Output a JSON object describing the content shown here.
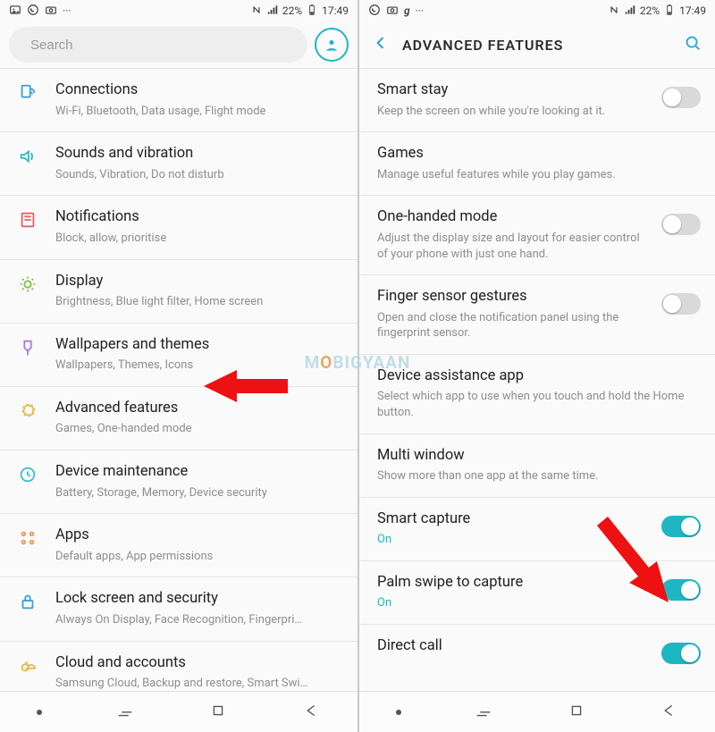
{
  "status": {
    "battery": "22%",
    "time": "17:49"
  },
  "left": {
    "search_placeholder": "Search",
    "items": [
      {
        "title": "Connections",
        "sub": "Wi-Fi, Bluetooth, Data usage, Flight mode"
      },
      {
        "title": "Sounds and vibration",
        "sub": "Sounds, Vibration, Do not disturb"
      },
      {
        "title": "Notifications",
        "sub": "Block, allow, prioritise"
      },
      {
        "title": "Display",
        "sub": "Brightness, Blue light filter, Home screen"
      },
      {
        "title": "Wallpapers and themes",
        "sub": "Wallpapers, Themes, Icons"
      },
      {
        "title": "Advanced features",
        "sub": "Games, One-handed mode"
      },
      {
        "title": "Device maintenance",
        "sub": "Battery, Storage, Memory, Device security"
      },
      {
        "title": "Apps",
        "sub": "Default apps, App permissions"
      },
      {
        "title": "Lock screen and security",
        "sub": "Always On Display, Face Recognition, Fingerpri…"
      },
      {
        "title": "Cloud and accounts",
        "sub": "Samsung Cloud, Backup and restore, Smart Swi…"
      }
    ]
  },
  "right": {
    "header": "ADVANCED FEATURES",
    "items": [
      {
        "title": "Smart stay",
        "sub": "Keep the screen on while you're looking at it.",
        "toggle": "off",
        "wrap": true
      },
      {
        "title": "Games",
        "sub": "Manage useful features while you play games."
      },
      {
        "title": "One-handed mode",
        "sub": "Adjust the display size and layout for easier control of your phone with just one hand.",
        "toggle": "off",
        "wrap": true
      },
      {
        "title": "Finger sensor gestures",
        "sub": "Open and close the notification panel using the fingerprint sensor.",
        "toggle": "off",
        "wrap": true
      },
      {
        "title": "Device assistance app",
        "sub": "Select which app to use when you touch and hold the Home button.",
        "wrap": true
      },
      {
        "title": "Multi window",
        "sub": "Show more than one app at the same time."
      },
      {
        "title": "Smart capture",
        "sub": "On",
        "subon": true,
        "toggle": "on"
      },
      {
        "title": "Palm swipe to capture",
        "sub": "On",
        "subon": true,
        "toggle": "on"
      },
      {
        "title": "Direct call",
        "sub": "",
        "toggle": "on"
      }
    ]
  },
  "watermark": {
    "pre": "M",
    "o": "O",
    "post": "BIGYAAN"
  }
}
